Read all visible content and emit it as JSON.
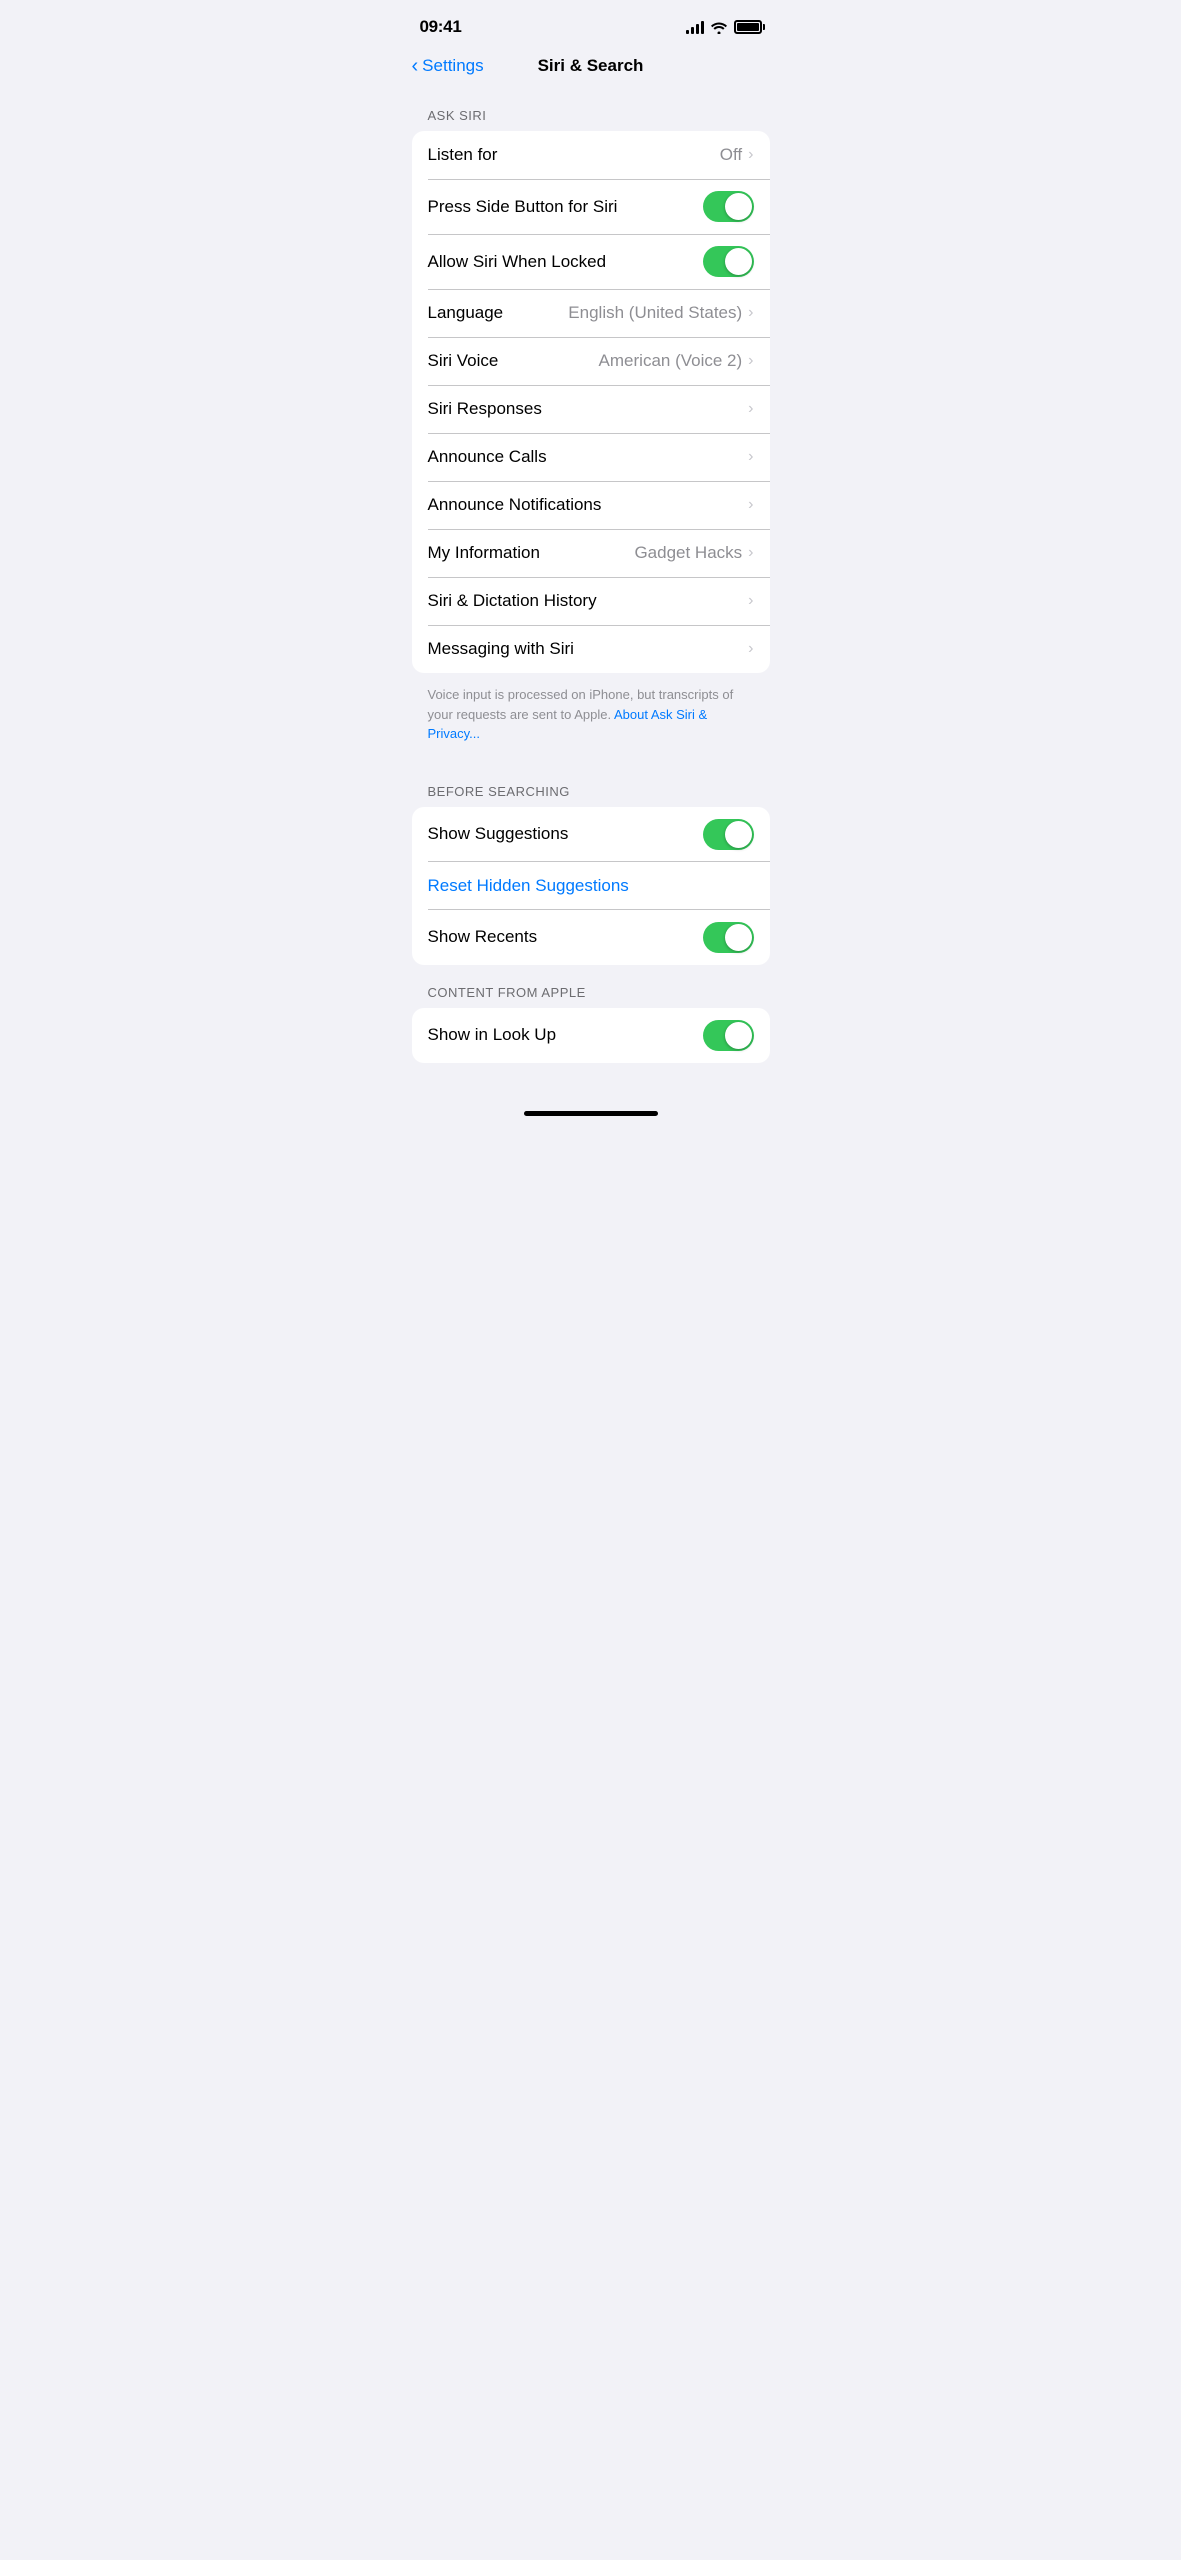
{
  "statusBar": {
    "time": "09:41",
    "icons": {
      "signal": "signal-icon",
      "wifi": "wifi-icon",
      "battery": "battery-icon"
    }
  },
  "header": {
    "backLabel": "Settings",
    "title": "Siri & Search"
  },
  "sections": {
    "askSiri": {
      "label": "ASK SIRI",
      "rows": [
        {
          "id": "listen-for",
          "label": "Listen for",
          "rightText": "Off",
          "type": "nav"
        },
        {
          "id": "press-side-button",
          "label": "Press Side Button for Siri",
          "rightText": "",
          "type": "toggle",
          "toggleOn": true
        },
        {
          "id": "allow-when-locked",
          "label": "Allow Siri When Locked",
          "rightText": "",
          "type": "toggle",
          "toggleOn": true
        },
        {
          "id": "language",
          "label": "Language",
          "rightText": "English (United States)",
          "type": "nav"
        },
        {
          "id": "siri-voice",
          "label": "Siri Voice",
          "rightText": "American (Voice 2)",
          "type": "nav"
        },
        {
          "id": "siri-responses",
          "label": "Siri Responses",
          "rightText": "",
          "type": "nav"
        },
        {
          "id": "announce-calls",
          "label": "Announce Calls",
          "rightText": "",
          "type": "nav"
        },
        {
          "id": "announce-notifications",
          "label": "Announce Notifications",
          "rightText": "",
          "type": "nav"
        },
        {
          "id": "my-information",
          "label": "My Information",
          "rightText": "Gadget Hacks",
          "type": "nav"
        },
        {
          "id": "siri-dictation-history",
          "label": "Siri & Dictation History",
          "rightText": "",
          "type": "nav"
        },
        {
          "id": "messaging-with-siri",
          "label": "Messaging with Siri",
          "rightText": "",
          "type": "nav"
        }
      ],
      "footerText": "Voice input is processed on iPhone, but transcripts of your requests are sent to Apple.",
      "footerLinkText": "About Ask Siri & Privacy...",
      "footerLinkHref": "#"
    },
    "beforeSearching": {
      "label": "BEFORE SEARCHING",
      "rows": [
        {
          "id": "show-suggestions",
          "label": "Show Suggestions",
          "rightText": "",
          "type": "toggle",
          "toggleOn": true
        },
        {
          "id": "reset-hidden-suggestions",
          "label": "Reset Hidden Suggestions",
          "rightText": "",
          "type": "blue-link"
        },
        {
          "id": "show-recents",
          "label": "Show Recents",
          "rightText": "",
          "type": "toggle",
          "toggleOn": true
        }
      ]
    },
    "contentFromApple": {
      "label": "CONTENT FROM APPLE",
      "rows": [
        {
          "id": "show-in-look-up",
          "label": "Show in Look Up",
          "rightText": "",
          "type": "toggle",
          "toggleOn": true
        }
      ]
    }
  },
  "homeIndicator": true
}
